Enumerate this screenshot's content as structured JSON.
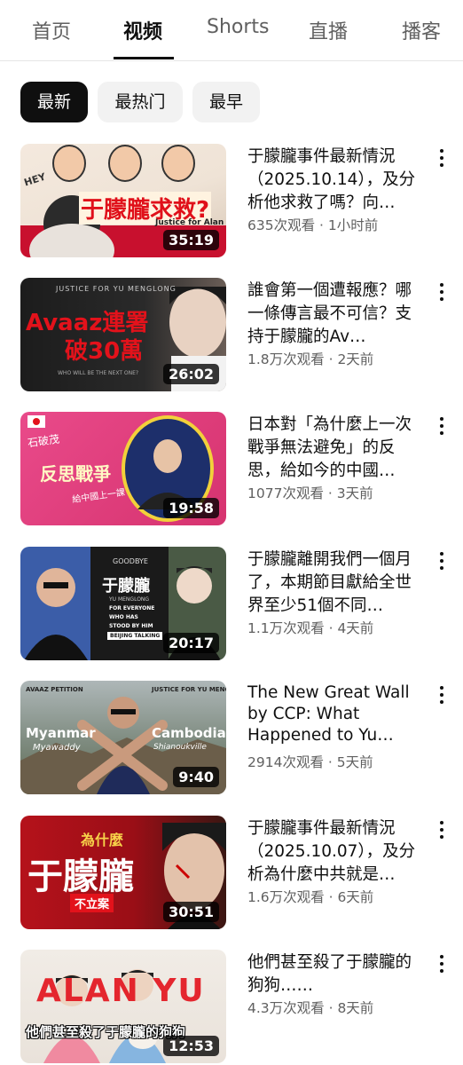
{
  "tabs": [
    {
      "label": "首页"
    },
    {
      "label": "视频"
    },
    {
      "label": "Shorts"
    },
    {
      "label": "直播"
    },
    {
      "label": "播客"
    }
  ],
  "chips": [
    {
      "label": "最新"
    },
    {
      "label": "最热门"
    },
    {
      "label": "最早"
    }
  ],
  "colors": {
    "active": "#0f0f0f",
    "chip_bg": "#f2f2f2",
    "secondary_text": "#606060"
  },
  "videos": [
    {
      "title": "于朦朧事件最新情況（2025.10.14），及分析他求救了嗎？向…",
      "views": "635次观看",
      "age": "1小时前",
      "duration": "35:19",
      "thumb_text": [
        "于朦朧求救?",
        "Justice for Alan",
        "HEY"
      ]
    },
    {
      "title": "誰會第一個遭報應？哪一條傳言最不可信？支持于朦朧的Av…",
      "views": "1.8万次观看",
      "age": "2天前",
      "duration": "26:02",
      "thumb_text": [
        "JUSTICE FOR YU MENGLONG",
        "Avaaz連署",
        "破30萬",
        "WHO WILL BE THE NEXT ONE?"
      ]
    },
    {
      "title": "日本對「為什麼上一次戰爭無法避免」的反思，給如今的中國…",
      "views": "1077次观看",
      "age": "3天前",
      "duration": "19:58",
      "thumb_text": [
        "石破茂",
        "反思戰爭",
        "給中國上一課"
      ]
    },
    {
      "title": "于朦朧離開我們一個月了，本期節目獻給全世界至少51個不同…",
      "views": "1.1万次观看",
      "age": "4天前",
      "duration": "20:17",
      "thumb_text": [
        "GOODBYE",
        "于朦朧",
        "YU MENGLONG",
        "FOR EVERYONE",
        "WHO HAS",
        "STOOD BY HIM",
        "BEIJING TALKING"
      ]
    },
    {
      "title": "The New Great Wall by CCP: What Happened to Yu Men…",
      "views": "2914次观看",
      "age": "5天前",
      "duration": "9:40",
      "thumb_text": [
        "AVAAZ PETITION",
        "JUSTICE FOR YU MENGLONG",
        "Myanmar",
        "Myawaddy",
        "Cambodia",
        "Shianoukville"
      ]
    },
    {
      "title": "于朦朧事件最新情況（2025.10.07），及分析為什麼中共就是…",
      "views": "1.6万次观看",
      "age": "6天前",
      "duration": "30:51",
      "thumb_text": [
        "為什麼",
        "于朦朧",
        "不立案"
      ]
    },
    {
      "title": "他們甚至殺了于朦朧的狗狗……",
      "views": "4.3万次观看",
      "age": "8天前",
      "duration": "12:53",
      "thumb_text": [
        "ALAN YU",
        "他們甚至殺了于朦朧的狗狗"
      ]
    }
  ]
}
